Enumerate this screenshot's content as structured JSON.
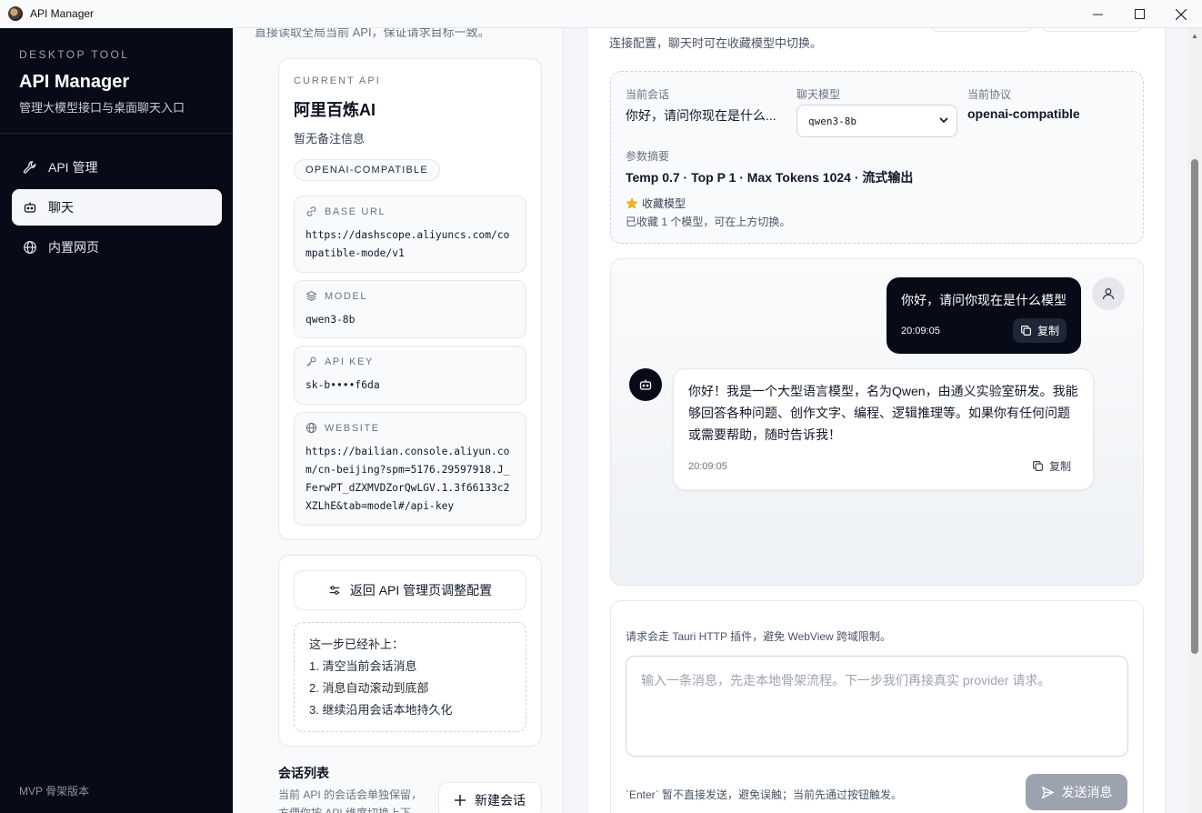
{
  "window": {
    "title": "API Manager"
  },
  "sidebar": {
    "eyebrow": "DESKTOP TOOL",
    "title": "API Manager",
    "subtitle": "管理大模型接口与桌面聊天入口",
    "items": [
      {
        "label": "API 管理",
        "icon": "wrench-icon"
      },
      {
        "label": "聊天",
        "icon": "robot-icon",
        "active": true
      },
      {
        "label": "内置网页",
        "icon": "globe-icon"
      }
    ],
    "footer": "MVP 骨架版本"
  },
  "middle": {
    "top_text": "直接读取全局当前 API，保证请求目标一致。",
    "current_api": {
      "eyebrow": "CURRENT API",
      "name": "阿里百炼AI",
      "note": "暂无备注信息",
      "badge": "OPENAI-COMPATIBLE",
      "fields": [
        {
          "label": "BASE URL",
          "icon": "link-icon",
          "value": "https://dashscope.aliyuncs.com/compatible-mode/v1"
        },
        {
          "label": "MODEL",
          "icon": "layers-icon",
          "value": "qwen3-8b"
        },
        {
          "label": "API KEY",
          "icon": "key-icon",
          "value": "sk-b••••f6da"
        },
        {
          "label": "WEBSITE",
          "icon": "globe-icon",
          "value": "https://bailian.console.aliyun.com/cn-beijing?spm=5176.29597918.J_FerwPT_dZXMVDZorQwLGV.1.3f66133c2XZLhE&tab=model#/api-key"
        }
      ]
    },
    "back_button": "返回 API 管理页调整配置",
    "steps": {
      "title": "这一步已经补上：",
      "items": [
        "1. 清空当前会话消息",
        "2. 消息自动滚动到底部",
        "3. 继续沿用会话本地持久化"
      ]
    },
    "sessions": {
      "title": "会话列表",
      "desc": "当前 API 的会话会单独保留，方便你按 API 维度切换上下",
      "new_button": "新建会话"
    }
  },
  "right": {
    "top_text": "连接配置，聊天时可在收藏模型中切换。",
    "info": {
      "session_label": "当前会话",
      "session_value": "你好，请问你现在是什么...",
      "model_label": "聊天模型",
      "model_value": "qwen3-8b",
      "protocol_label": "当前协议",
      "protocol_value": "openai-compatible",
      "params_label": "参数摘要",
      "params_value": "Temp 0.7 · Top P 1 · Max Tokens 1024 · 流式输出",
      "fav_label": "收藏模型",
      "fav_desc": "已收藏 1 个模型，可在上方切换。"
    },
    "messages": [
      {
        "role": "user",
        "text": "你好，请问你现在是什么模型",
        "time": "20:09:05",
        "copy": "复制"
      },
      {
        "role": "assistant",
        "text": "你好！我是一个大型语言模型，名为Qwen，由通义实验室研发。我能够回答各种问题、创作文字、编程、逻辑推理等。如果你有任何问题或需要帮助，随时告诉我！",
        "time": "20:09:05",
        "copy": "复制"
      }
    ],
    "composer": {
      "note": "请求会走 Tauri HTTP 插件，避免 WebView 跨域限制。",
      "placeholder": "输入一条消息，先走本地骨架流程。下一步我们再接真实 provider 请求。",
      "hint": "`Enter` 暂不直接发送，避免误触；当前先通过按钮触发。",
      "send_label": "发送消息"
    }
  },
  "colors": {
    "sidebar_bg": "#070b17",
    "accent_dark": "#070b17",
    "send_disabled": "#9ca3af"
  }
}
